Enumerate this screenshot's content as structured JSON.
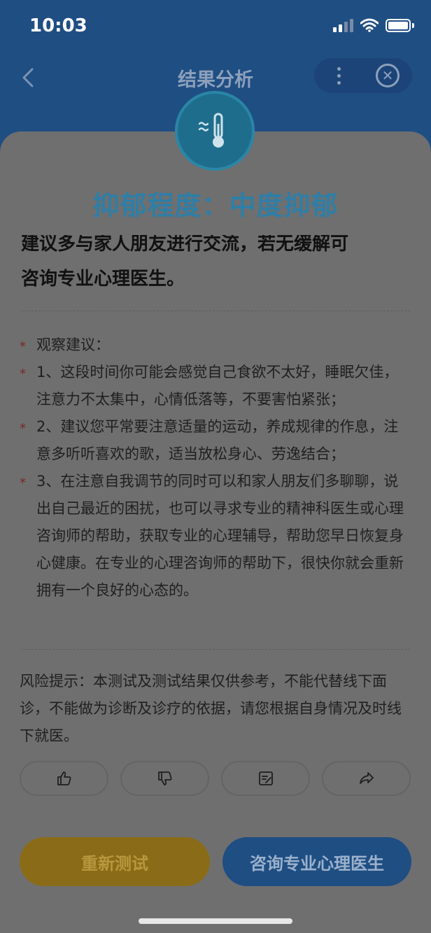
{
  "status_bar": {
    "time": "10:03"
  },
  "nav": {
    "title": "结果分析"
  },
  "result": {
    "level_title": "抑郁程度：中度抑郁"
  },
  "advice": {
    "line1": "建议多与家人朋友进行交流，若无缓解可",
    "line2": "咨询专业心理医生。"
  },
  "observations": [
    {
      "text": "观察建议："
    },
    {
      "text": "1、这段时间你可能会感觉自己食欲不太好，睡眠欠佳，注意力不太集中，心情低落等，不要害怕紧张；"
    },
    {
      "text": "2、建议您平常要注意适量的运动，养成规律的作息，注意多听听喜欢的歌，适当放松身心、劳逸结合；"
    },
    {
      "text": "3、在注意自我调节的同时可以和家人朋友们多聊聊，说出自己最近的困扰，也可以寻求专业的精神科医生或心理咨询师的帮助，获取专业的心理辅导，帮助您早日恢复身心健康。在专业的心理咨询师的帮助下，很快你就会重新拥有一个良好的心态的。"
    }
  ],
  "risk_notice": "风险提示：本测试及测试结果仅供参考，不能代替线下面诊，不能做为诊断及诊疗的依据，请您根据自身情况及时线下就医。",
  "feedback_icons": [
    "thumbs-up-icon",
    "thumbs-down-icon",
    "edit-note-icon",
    "share-icon"
  ],
  "actions": {
    "retest_label": "重新测试",
    "consult_label": "咨询专业心理医生"
  },
  "colors": {
    "header_bg": "#1f4e83",
    "title_accent": "#2f7ea6",
    "retest_bg": "#8a6c18",
    "consult_bg": "#1f4e83"
  }
}
